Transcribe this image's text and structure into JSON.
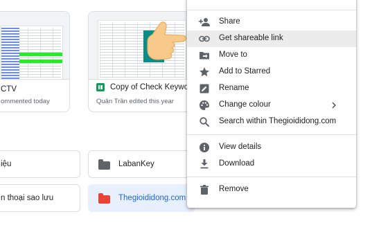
{
  "cards": [
    {
      "title": "CTV",
      "subtitle": "ommented today"
    },
    {
      "title": "Copy of Check Keyword",
      "subtitle": "Quân Trần edited this year"
    }
  ],
  "folders": [
    {
      "label": "iệu"
    },
    {
      "label": "LabanKey"
    },
    {
      "label": "n thoại sao lưu"
    },
    {
      "label": "Thegioididong.com",
      "color": "#ea4335"
    }
  ],
  "context_menu": {
    "items": [
      {
        "label": "Share",
        "icon": "add-person-icon"
      },
      {
        "label": "Get shareable link",
        "icon": "link-icon"
      },
      {
        "label": "Move to",
        "icon": "move-to-folder-icon"
      },
      {
        "label": "Add to Starred",
        "icon": "star-icon"
      },
      {
        "label": "Rename",
        "icon": "rename-pencil-icon"
      },
      {
        "label": "Change colour",
        "icon": "palette-icon"
      },
      {
        "label": "Search within Thegioididong.com",
        "icon": "search-icon"
      },
      {
        "label": "View details",
        "icon": "info-icon"
      },
      {
        "label": "Download",
        "icon": "download-icon"
      },
      {
        "label": "Remove",
        "icon": "trash-icon"
      }
    ],
    "hovered_item": "Get shareable link"
  },
  "colors": {
    "accent_blue": "#1967d2",
    "selected_background": "#e8f0fe",
    "sheets_green": "#0f9d58",
    "menu_icon": "#5f6368"
  }
}
